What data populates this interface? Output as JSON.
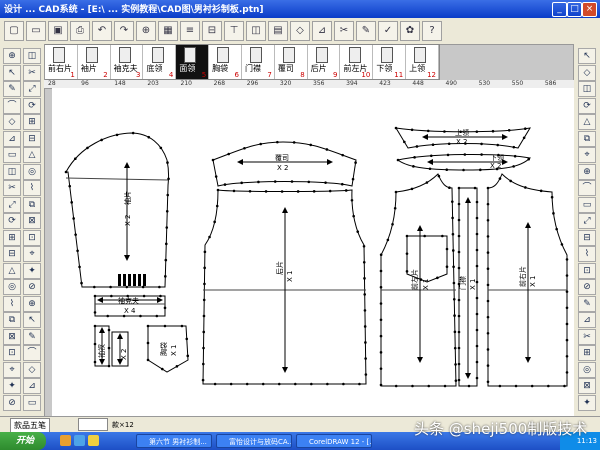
{
  "window": {
    "title": "设计 ... CAD系统 - [E:\\ ... 实例教程\\CAD图\\男衬衫制板.ptn]",
    "btn_min": "_",
    "btn_max": "□",
    "btn_close": "×"
  },
  "piece_bar": {
    "pieces": [
      {
        "label": "前右片",
        "num": "1"
      },
      {
        "label": "袖片",
        "num": "2"
      },
      {
        "label": "袖克夫",
        "num": "3"
      },
      {
        "label": "底领",
        "num": "4"
      },
      {
        "label": "面领",
        "num": "5"
      },
      {
        "label": "胸袋",
        "num": "6"
      },
      {
        "label": "门襟",
        "num": "7"
      },
      {
        "label": "覆司",
        "num": "8"
      },
      {
        "label": "后片",
        "num": "9"
      },
      {
        "label": "前左片",
        "num": "10"
      },
      {
        "label": "下领",
        "num": "11"
      },
      {
        "label": "上领",
        "num": "12"
      }
    ],
    "active_index": 4
  },
  "ruler": {
    "ticks": [
      "28",
      "96",
      "148",
      "203",
      "210",
      "268",
      "296",
      "320",
      "356",
      "394",
      "423",
      "448",
      "490",
      "530",
      "550",
      "586"
    ]
  },
  "pattern": {
    "pieces": [
      {
        "name": "袖片",
        "qty": "X 2"
      },
      {
        "name": "袖克夫",
        "qty": "X 4"
      },
      {
        "name": "覆司",
        "qty": "X 2"
      },
      {
        "name": "后片",
        "qty": "X 1"
      },
      {
        "name": "上领",
        "qty": "X 2"
      },
      {
        "name": "下领",
        "qty": "X 2"
      },
      {
        "name": "前左片",
        "qty": "X 1"
      },
      {
        "name": "门襟",
        "qty": "X 1"
      },
      {
        "name": "前右片",
        "qty": "X 1"
      },
      {
        "name": "胸袋",
        "qty": "X 1"
      },
      {
        "name": "袖衩",
        "qty": "X 2"
      }
    ]
  },
  "statusbar": {
    "tab_label": "款品五笔",
    "coords": "款×12"
  },
  "taskbar": {
    "start_label": "开始",
    "tasks": [
      "第六节 男衬衫制...",
      "富怡设计与放码CA...",
      "CorelDRAW 12 - [..."
    ],
    "clock": "11:13"
  },
  "watermark": "头条 @sheji500制版技术",
  "colors": {
    "title_bar": "#0a3cc8",
    "taskbar": "#1d4fc5",
    "start_button": "#2e8b2e",
    "pattern_point": "#000000",
    "piece_number": "#cc0000"
  }
}
